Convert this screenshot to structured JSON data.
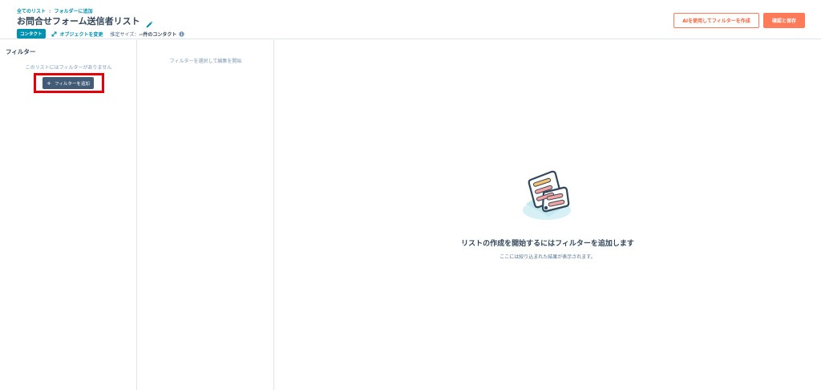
{
  "header": {
    "breadcrumb": {
      "all_lists": "全てのリスト",
      "separator": ":",
      "add_to_folder": "フォルダーに追加"
    },
    "title": "お問合せフォーム送信者リスト",
    "object_badge": "コンタクト",
    "change_object": "オブジェクトを変更",
    "estimated_size_label": "推定サイズ：",
    "estimated_size_value": "--件のコンタクト",
    "ai_filter_button": "AIを使用してフィルターを作成",
    "save_button": "確認と保存"
  },
  "filters_panel": {
    "heading": "フィルター",
    "empty_text": "このリストにはフィルターがありません",
    "add_filter_button": "フィルターを追加"
  },
  "editor_panel": {
    "hint": "フィルターを選択して編集を開始"
  },
  "main": {
    "empty_title": "リストの作成を開始するにはフィルターを追加します",
    "empty_subtitle": "ここには絞り込まれた結果が表示されます。"
  },
  "colors": {
    "accent_teal": "#0091ae",
    "accent_orange": "#ff7a59",
    "dark_button": "#425b76",
    "highlight_red": "#e3000b"
  }
}
